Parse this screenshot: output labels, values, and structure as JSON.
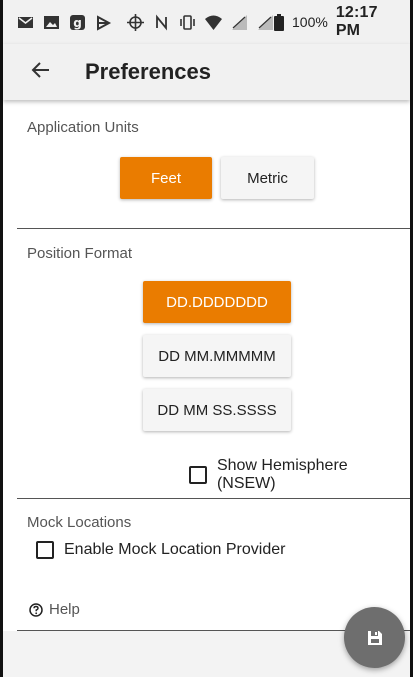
{
  "status_bar": {
    "battery": "100%",
    "time": "12:17 PM",
    "icons": [
      "gmail-icon",
      "photos-icon",
      "app-g-icon",
      "navigation-icon",
      "gps-icon",
      "nfc-icon",
      "vibrate-icon",
      "wifi-icon",
      "signal-icon",
      "signal-icon-2",
      "battery-icon"
    ]
  },
  "app_bar": {
    "title": "Preferences",
    "back_icon": "arrow-left-icon"
  },
  "application_units": {
    "title": "Application Units",
    "options": [
      {
        "label": "Feet",
        "selected": true
      },
      {
        "label": "Metric",
        "selected": false
      }
    ]
  },
  "position_format": {
    "title": "Position Format",
    "options": [
      {
        "label": "DD.DDDDDDD",
        "selected": true
      },
      {
        "label": "DD MM.MMMMM",
        "selected": false
      },
      {
        "label": "DD MM SS.SSSS",
        "selected": false
      }
    ],
    "show_hemisphere": {
      "label": "Show Hemisphere (NSEW)",
      "checked": false
    }
  },
  "mock_locations": {
    "title": "Mock Locations",
    "enable_mock": {
      "label": "Enable Mock Location Provider",
      "checked": false
    },
    "help": "Help",
    "help_icon": "help-circle-icon"
  },
  "fab": {
    "icon": "save-icon"
  },
  "colors": {
    "accent": "#ea7c00",
    "bar_bg": "#f1f1f1",
    "fab_bg": "#6e6e6e"
  }
}
